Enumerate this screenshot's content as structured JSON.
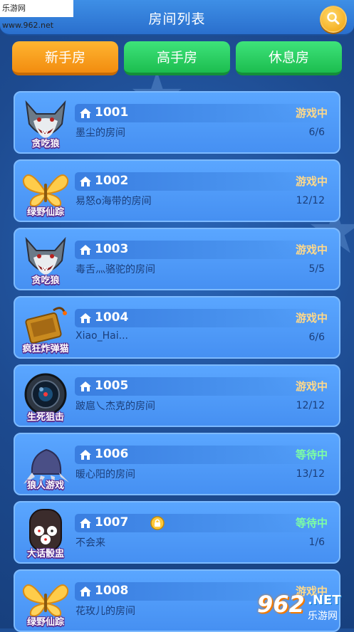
{
  "watermark_top": "乐游网 www.962.net",
  "header": {
    "title": "房间列表"
  },
  "tabs": [
    {
      "label": "新手房",
      "active": true
    },
    {
      "label": "高手房",
      "active": false
    },
    {
      "label": "休息房",
      "active": false
    }
  ],
  "rooms": [
    {
      "game": "贪吃狼",
      "icon": "wolf-icon",
      "id": "1001",
      "status": "游戏中",
      "name": "墨尘的房间",
      "count": "6/6",
      "locked": false
    },
    {
      "game": "绿野仙踪",
      "icon": "butterfly-icon",
      "id": "1002",
      "status": "游戏中",
      "name": "易怒o海带的房间",
      "count": "12/12",
      "locked": false
    },
    {
      "game": "贪吃狼",
      "icon": "wolf-icon",
      "id": "1003",
      "status": "游戏中",
      "name": "毒舌灬骆驼的房间",
      "count": "5/5",
      "locked": false
    },
    {
      "game": "疯狂炸弹猫",
      "icon": "bomb-box-icon",
      "id": "1004",
      "status": "游戏中",
      "name": "Xiao_Hai...",
      "count": "6/6",
      "locked": false
    },
    {
      "game": "生死狙击",
      "icon": "scope-icon",
      "id": "1005",
      "status": "游戏中",
      "name": "跛扈乀杰克的房间",
      "count": "12/12",
      "locked": false
    },
    {
      "game": "狼人游戏",
      "icon": "claw-icon",
      "id": "1006",
      "status": "等待中",
      "name": "暖心阳的房间",
      "count": "13/12",
      "locked": false
    },
    {
      "game": "大话骰盅",
      "icon": "dice-cup-icon",
      "id": "1007",
      "status": "等待中",
      "name": "不会来",
      "count": "1/6",
      "locked": true
    },
    {
      "game": "绿野仙踪",
      "icon": "butterfly-icon",
      "id": "1008",
      "status": "游戏中",
      "name": "花玫儿的房间",
      "count": "",
      "locked": false
    }
  ],
  "watermark_bottom": {
    "big": "962",
    "net": ".NET",
    "cn": "乐游网"
  },
  "colors": {
    "playing": "#ffd98a",
    "waiting": "#7dffa3",
    "tab_active": "#f7a21f",
    "tab_inactive": "#22c556"
  }
}
